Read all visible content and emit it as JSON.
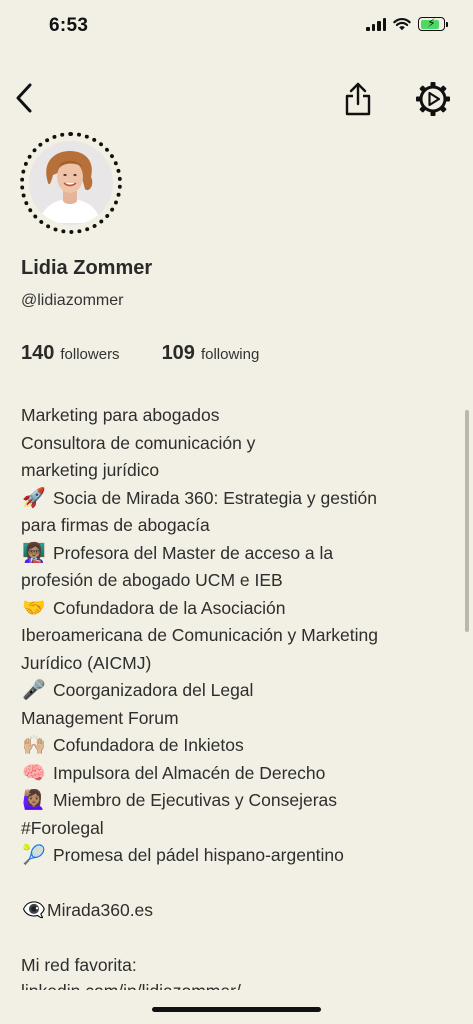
{
  "status_bar": {
    "time": "6:53",
    "icons": [
      "signal-icon",
      "wifi-icon",
      "battery-charging-icon"
    ]
  },
  "nav": {
    "icons": [
      "chevron-left-icon",
      "share-icon",
      "settings-play-icon"
    ]
  },
  "profile": {
    "name": "Lidia Zommer",
    "handle": "@lidiazommer",
    "followers_count": "140",
    "followers_label": "followers",
    "following_count": "109",
    "following_label": "following"
  },
  "bio": {
    "lines": [
      {
        "emoji": "",
        "text": "Marketing para abogados"
      },
      {
        "emoji": "",
        "text": "Consultora de comunicación y"
      },
      {
        "emoji": "",
        "text": "marketing jurídico"
      },
      {
        "emoji": "🚀",
        "text": "Socia de Mirada 360: Estrategia y gestión"
      },
      {
        "emoji": "",
        "text": "para firmas de abogacía"
      },
      {
        "emoji": "👩🏽‍🏫",
        "text": "Profesora del Master de acceso a la"
      },
      {
        "emoji": "",
        "text": "profesión de abogado UCM e IEB"
      },
      {
        "emoji": "🤝",
        "text": "Cofundadora de la Asociación"
      },
      {
        "emoji": "",
        "text": "Iberoamericana de Comunicación y Marketing"
      },
      {
        "emoji": "",
        "text": "Jurídico (AICMJ)"
      },
      {
        "emoji": "🎤",
        "text": "Coorganizadora del Legal"
      },
      {
        "emoji": "",
        "text": "Management Forum"
      },
      {
        "emoji": "🙌🏼",
        "text": "Cofundadora de Inkietos"
      },
      {
        "emoji": "🧠",
        "text": "Impulsora del Almacén de Derecho"
      },
      {
        "emoji": "🙋🏽‍♀️",
        "text": "Miembro de Ejecutivas y Consejeras"
      },
      {
        "emoji": "",
        "text": "#Forolegal"
      },
      {
        "emoji": "🎾",
        "text": "Promesa del pádel hispano-argentino"
      }
    ],
    "link_emoji": "👁‍🗨",
    "link_text": "Mirada360.es",
    "favorite_label": "Mi red favorita:",
    "cut_text": "linkedin.com/in/lidiazommer/"
  },
  "colors": {
    "background": "#f2efe4",
    "battery_green": "#4cd964",
    "text": "#2e2e2e"
  }
}
